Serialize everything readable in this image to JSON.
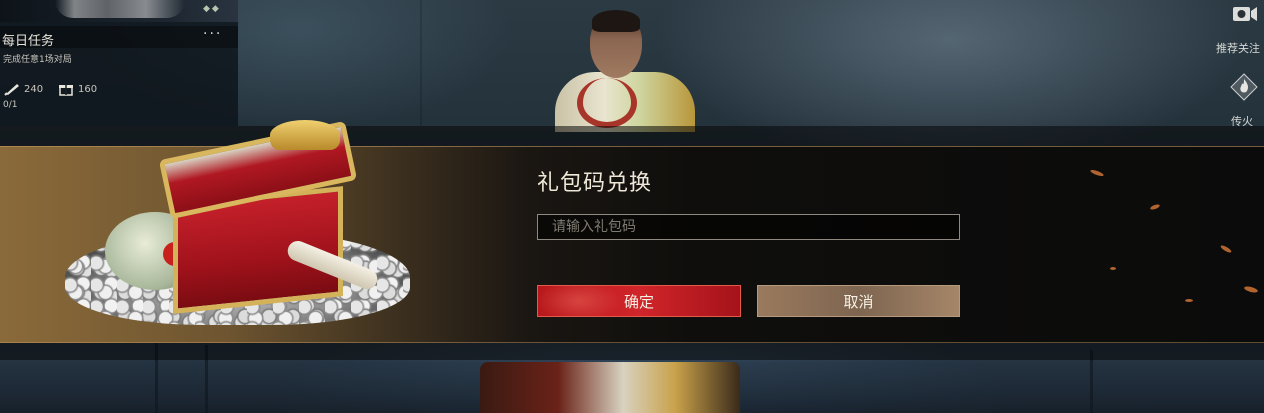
{
  "task_panel": {
    "title": "每日任务",
    "more": "···",
    "description": "完成任意1场对局",
    "rewards": [
      {
        "icon": "scroll-icon",
        "value": "240"
      },
      {
        "icon": "gift-icon",
        "value": "160"
      }
    ],
    "progress": "0/1"
  },
  "side_buttons": [
    {
      "label": "推荐关注",
      "icon": "camera-icon"
    },
    {
      "label": "传火",
      "icon": "flame-icon"
    }
  ],
  "dialog": {
    "title": "礼包码兑换",
    "input_placeholder": "请输入礼包码",
    "input_value": "",
    "confirm_label": "确定",
    "cancel_label": "取消"
  },
  "colors": {
    "confirm": "#c81e24",
    "cancel": "#8a6e55",
    "title_text": "#efe8d8",
    "band_gold": "#8a6a3a"
  }
}
